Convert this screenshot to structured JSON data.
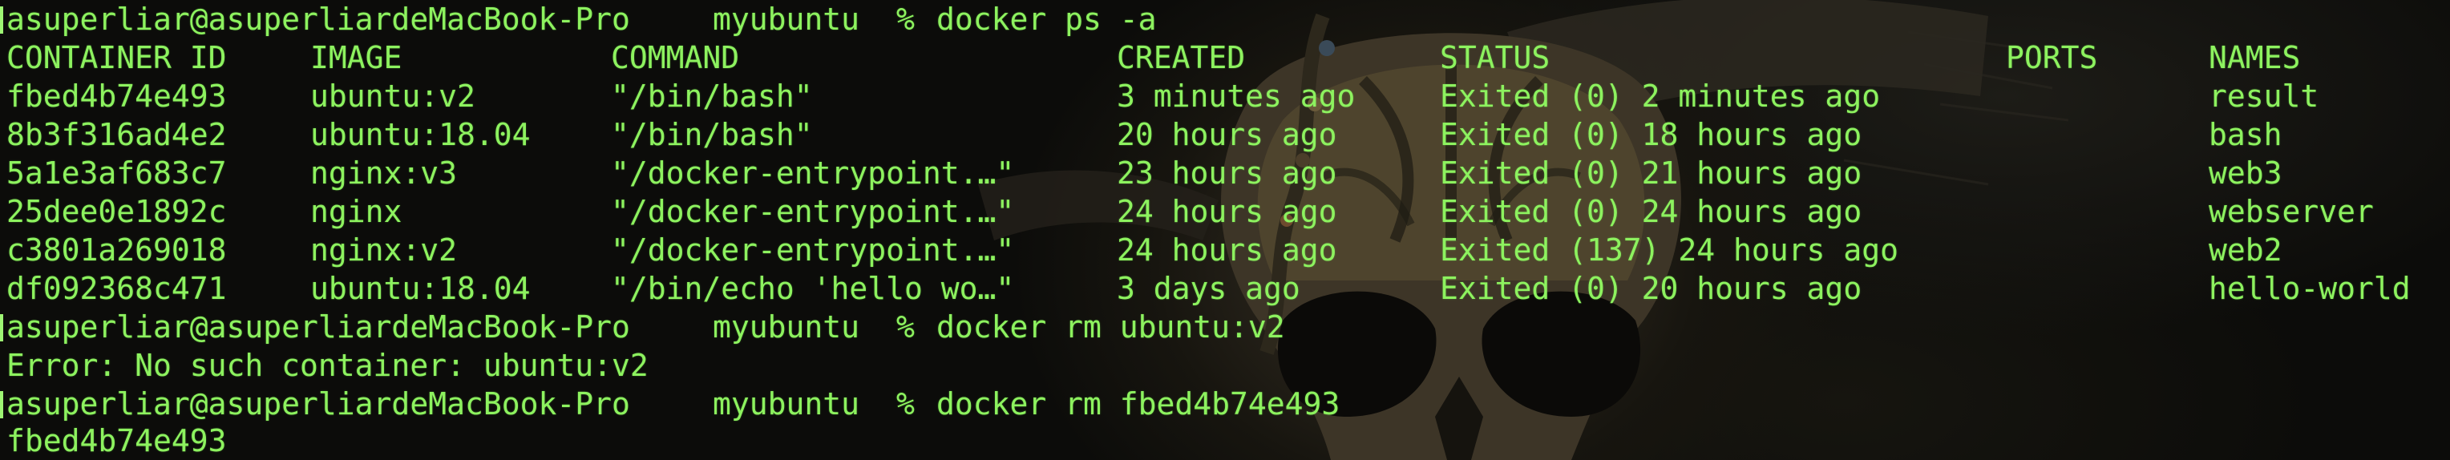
{
  "colors": {
    "text": "#8df25f",
    "background": "#0c0c0a"
  },
  "prompts": [
    {
      "user_host": "asuperliar@asuperliardeMacBook-Pro",
      "cwd": "myubuntu",
      "symbol": "%",
      "command": "docker ps -a"
    },
    {
      "user_host": "asuperliar@asuperliardeMacBook-Pro",
      "cwd": "myubuntu",
      "symbol": "%",
      "command": "docker rm ubuntu:v2"
    },
    {
      "user_host": "asuperliar@asuperliardeMacBook-Pro",
      "cwd": "myubuntu",
      "symbol": "%",
      "command": "docker rm fbed4b74e493"
    }
  ],
  "ps_table": {
    "headers": [
      "CONTAINER ID",
      "IMAGE",
      "COMMAND",
      "CREATED",
      "STATUS",
      "PORTS",
      "NAMES"
    ],
    "rows": [
      [
        "fbed4b74e493",
        "ubuntu:v2",
        "\"/bin/bash\"",
        "3 minutes ago",
        "Exited (0) 2 minutes ago",
        "",
        "result"
      ],
      [
        "8b3f316ad4e2",
        "ubuntu:18.04",
        "\"/bin/bash\"",
        "20 hours ago",
        "Exited (0) 18 hours ago",
        "",
        "bash"
      ],
      [
        "5a1e3af683c7",
        "nginx:v3",
        "\"/docker-entrypoint.…\"",
        "23 hours ago",
        "Exited (0) 21 hours ago",
        "",
        "web3"
      ],
      [
        "25dee0e1892c",
        "nginx",
        "\"/docker-entrypoint.…\"",
        "24 hours ago",
        "Exited (0) 24 hours ago",
        "",
        "webserver"
      ],
      [
        "c3801a269018",
        "nginx:v2",
        "\"/docker-entrypoint.…\"",
        "24 hours ago",
        "Exited (137) 24 hours ago",
        "",
        "web2"
      ],
      [
        "df092368c471",
        "ubuntu:18.04",
        "\"/bin/echo 'hello wo…\"",
        "3 days ago",
        "Exited (0) 20 hours ago",
        "",
        "hello-world"
      ]
    ]
  },
  "outputs": {
    "rm_error": "Error: No such container: ubuntu:v2",
    "rm_result": "fbed4b74e493"
  }
}
